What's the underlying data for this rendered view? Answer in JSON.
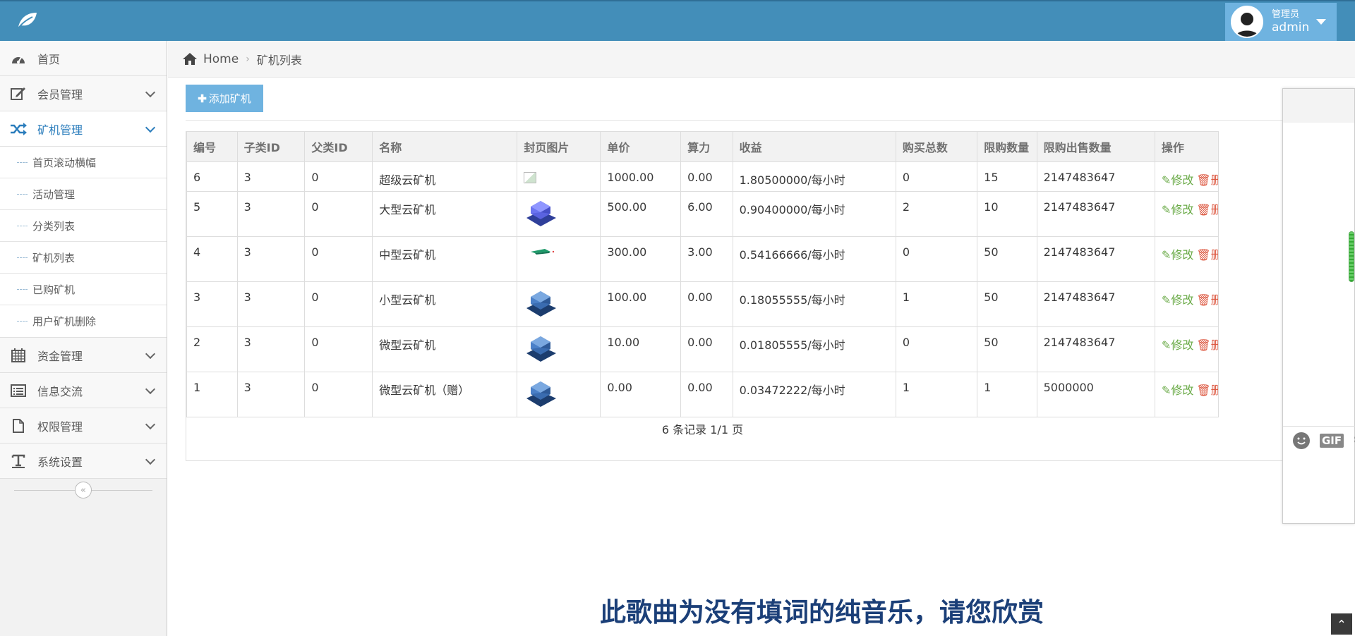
{
  "header": {
    "user_role": "管理员",
    "user_name": "admin"
  },
  "sidebar": {
    "items": [
      {
        "label": "首页"
      },
      {
        "label": "会员管理"
      },
      {
        "label": "矿机管理"
      },
      {
        "label": "资金管理"
      },
      {
        "label": "信息交流"
      },
      {
        "label": "权限管理"
      },
      {
        "label": "系统设置"
      }
    ],
    "sub_items": [
      "首页滚动横幅",
      "活动管理",
      "分类列表",
      "矿机列表",
      "已购矿机",
      "用户矿机删除"
    ]
  },
  "breadcrumb": {
    "home": "Home",
    "current": "矿机列表"
  },
  "toolbar": {
    "add_label": "添加矿机"
  },
  "table": {
    "columns": [
      "编号",
      "子类ID",
      "父类ID",
      "名称",
      "封页图片",
      "单价",
      "算力",
      "收益",
      "购买总数",
      "限购数量",
      "限购出售数量",
      "操作"
    ],
    "rows": [
      {
        "id": "6",
        "sub_id": "3",
        "parent_id": "0",
        "name": "超级云矿机",
        "price": "1000.00",
        "power": "0.00",
        "income": "1.80500000/每小时",
        "total": "0",
        "limit": "15",
        "sell_limit": "2147483647"
      },
      {
        "id": "5",
        "sub_id": "3",
        "parent_id": "0",
        "name": "大型云矿机",
        "price": "500.00",
        "power": "6.00",
        "income": "0.90400000/每小时",
        "total": "2",
        "limit": "10",
        "sell_limit": "2147483647"
      },
      {
        "id": "4",
        "sub_id": "3",
        "parent_id": "0",
        "name": "中型云矿机",
        "price": "300.00",
        "power": "3.00",
        "income": "0.54166666/每小时",
        "total": "0",
        "limit": "50",
        "sell_limit": "2147483647"
      },
      {
        "id": "3",
        "sub_id": "3",
        "parent_id": "0",
        "name": "小型云矿机",
        "price": "100.00",
        "power": "0.00",
        "income": "0.18055555/每小时",
        "total": "1",
        "limit": "50",
        "sell_limit": "2147483647"
      },
      {
        "id": "2",
        "sub_id": "3",
        "parent_id": "0",
        "name": "微型云矿机",
        "price": "10.00",
        "power": "0.00",
        "income": "0.01805555/每小时",
        "total": "0",
        "limit": "50",
        "sell_limit": "2147483647"
      },
      {
        "id": "1",
        "sub_id": "3",
        "parent_id": "0",
        "name": "微型云矿机（赠）",
        "price": "0.00",
        "power": "0.00",
        "income": "0.03472222/每小时",
        "total": "1",
        "limit": "1",
        "sell_limit": "5000000"
      }
    ],
    "edit_label": "修改",
    "delete_label": "删除",
    "pager": "6 条记录 1/1 页"
  },
  "chat": {
    "gif_label": "GIF"
  },
  "overlay": {
    "subtitle": "此歌曲为没有填词的纯音乐，请您欣赏"
  },
  "colors": {
    "topbar": "#438eb9",
    "accent": "#6fb3e0",
    "active_nav": "#2b7dbc",
    "edit": "#69aa46",
    "delete": "#dd5a43"
  }
}
